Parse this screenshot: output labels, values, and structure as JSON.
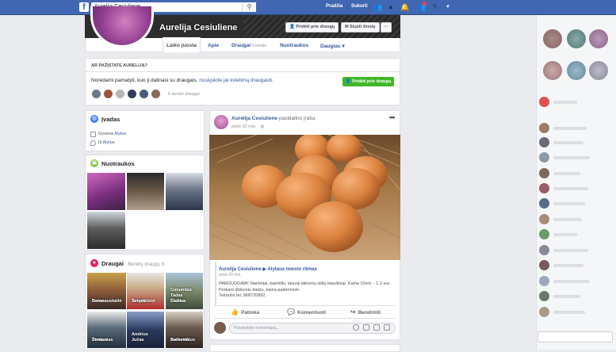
{
  "topbar": {
    "logo": "f",
    "search_value": "Aurelija Cesiuliene",
    "nav": {
      "home": "Pradžia",
      "create": "Sukurti"
    },
    "icons": [
      "friends-icon",
      "messenger-icon",
      "bell-icon",
      "friend-requests-icon",
      "help-icon",
      "caret-down-icon"
    ]
  },
  "profile": {
    "name": "Aurelija Cesiuliene",
    "add_friend": "Pridėti prie draugų",
    "send_message": "Siųsti žinutę",
    "more": "···"
  },
  "tabs": [
    {
      "label": "Laiko juosta"
    },
    {
      "label": "Apie"
    },
    {
      "label": "Draugai",
      "count": "6 bendri"
    },
    {
      "label": "Nuotraukos"
    },
    {
      "label": "Daugiau ▾"
    }
  ],
  "know": {
    "heading": "AR PAŽĮSTATE AURELIJĄ?",
    "text": "Norėdami pamatyti, kuo ji dalinasi su draugais, ",
    "link": "nusiųskite jai kvietimą draugauti.",
    "button": "Pridėti prie draugų",
    "mutual": "6 bendri draugai"
  },
  "intro": {
    "title": "Įvadas",
    "lives_prefix": "Gyvena ",
    "lives_city": "Alytus",
    "from_prefix": "Iš ",
    "from_city": "Alytus"
  },
  "photos": {
    "title": "Nuotraukos"
  },
  "friends": {
    "title": "Draugai",
    "subtitle": " · Bendrų draugų: 6",
    "list": [
      {
        "line1": "Daina",
        "line2": "Baranauskaitė"
      },
      {
        "line1": "Jurgita",
        "line2": "Šelevičienė"
      },
      {
        "line1": "Paulius",
        "line2": "Gimundas Tadas Čiukas"
      },
      {
        "line1": "Domantas",
        "line2": "Šimkus"
      },
      {
        "line1": "",
        "line2": "Andrius Jučas"
      },
      {
        "line1": "Robertas",
        "line2": "Barkevičius"
      }
    ]
  },
  "post": {
    "author": "Aurelija Cesiuliene",
    "action": " pasidalino įrašu.",
    "time": "prieš 20 min.",
    "more": "•••",
    "shared_author": "Aurelija Cesiuliene",
    "shared_group": "Alytaus miesto ritmas",
    "shared_time": "prieš 20 min.",
    "shared_text_1": "PARDUODAMI: Naminiai, kaimiški, laisvai laikomų vištų kiaušiniai. Kaina 10vnt. - 1.2 eur.",
    "shared_text_2": "Perkant didesniu kiekiu, kaina paderinsim.",
    "shared_text_3": "Teirautis tel. 868720892.",
    "like": "Patinka",
    "comment": "Komentuoti",
    "share": "Bendrinti",
    "comment_placeholder": "Parašykite komentarą..."
  }
}
